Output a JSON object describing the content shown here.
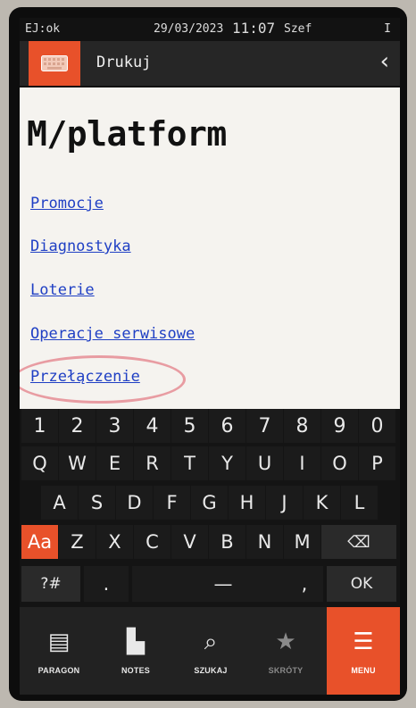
{
  "status": {
    "left": "EJ:ok",
    "date": "29/03/2023",
    "time": "11:07",
    "user": "Szef",
    "right": "I"
  },
  "titlebar": {
    "keyboard_icon": "keyboard-icon",
    "title": "Drukuj",
    "back_icon": "chevron-left-icon",
    "back_glyph": "‹"
  },
  "content": {
    "title": "M/platform",
    "links": [
      "Promocje",
      "Diagnostyka",
      "Loterie",
      "Operacje serwisowe",
      "Przełączenie"
    ]
  },
  "keyboard": {
    "numbers": [
      "1",
      "2",
      "3",
      "4",
      "5",
      "6",
      "7",
      "8",
      "9",
      "0"
    ],
    "row_q": [
      "Q",
      "W",
      "E",
      "R",
      "T",
      "Y",
      "U",
      "I",
      "O",
      "P"
    ],
    "row_a": [
      "A",
      "S",
      "D",
      "F",
      "G",
      "H",
      "J",
      "K",
      "L"
    ],
    "row_z": [
      "Z",
      "X",
      "C",
      "V",
      "B",
      "N",
      "M"
    ],
    "shift_label": "Aa",
    "backspace_icon": "backspace-icon",
    "backspace_glyph": "⌫",
    "symbols_label": "?#",
    "dot_label": ".",
    "space_label": "—",
    "comma_label": ",",
    "ok_label": "OK"
  },
  "nav": [
    {
      "label": "PARAGON",
      "icon": "receipt-icon",
      "glyph": "▤"
    },
    {
      "label": "NOTES",
      "icon": "bookmark-icon",
      "glyph": "▙"
    },
    {
      "label": "SZUKAJ",
      "icon": "search-icon",
      "glyph": "⌕"
    },
    {
      "label": "SKRÓTY",
      "icon": "star-icon",
      "glyph": "★"
    },
    {
      "label": "MENU",
      "icon": "hamburger-icon",
      "glyph": "☰"
    }
  ],
  "colors": {
    "accent": "#e8512a",
    "link": "#1f3fc4",
    "highlight_circle": "#e89ca2"
  }
}
